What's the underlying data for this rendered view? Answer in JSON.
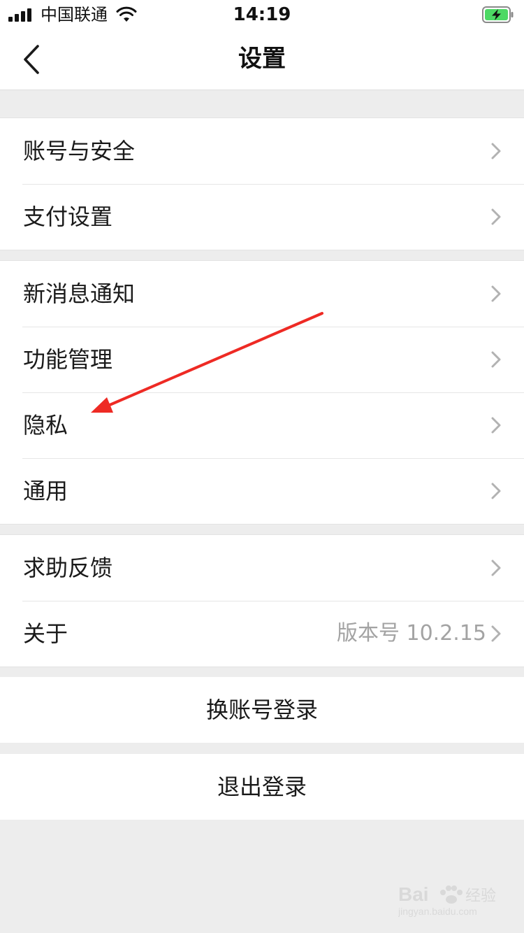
{
  "status_bar": {
    "carrier": "中国联通",
    "time": "14:19",
    "signal_bars": 4,
    "battery_state": "charging",
    "battery_color": "#4cd964"
  },
  "nav": {
    "title": "设置",
    "back_icon": "chevron-left-icon"
  },
  "groups": [
    {
      "items": [
        {
          "label": "账号与安全"
        },
        {
          "label": "支付设置"
        }
      ]
    },
    {
      "items": [
        {
          "label": "新消息通知"
        },
        {
          "label": "功能管理"
        },
        {
          "label": "隐私"
        },
        {
          "label": "通用"
        }
      ]
    },
    {
      "items": [
        {
          "label": "求助反馈"
        },
        {
          "label": "关于",
          "value": "版本号 10.2.15"
        }
      ]
    }
  ],
  "actions": {
    "switch_account": "换账号登录",
    "logout": "退出登录"
  },
  "annotation": {
    "type": "arrow",
    "color": "#ee2a24",
    "points_to": "隐私"
  },
  "colors": {
    "page_background": "#ededed",
    "card_background": "#ffffff",
    "secondary_text": "#a3a3a3"
  },
  "watermark": {
    "brand": "Baidu经验",
    "url": "jingyan.baidu.com"
  }
}
